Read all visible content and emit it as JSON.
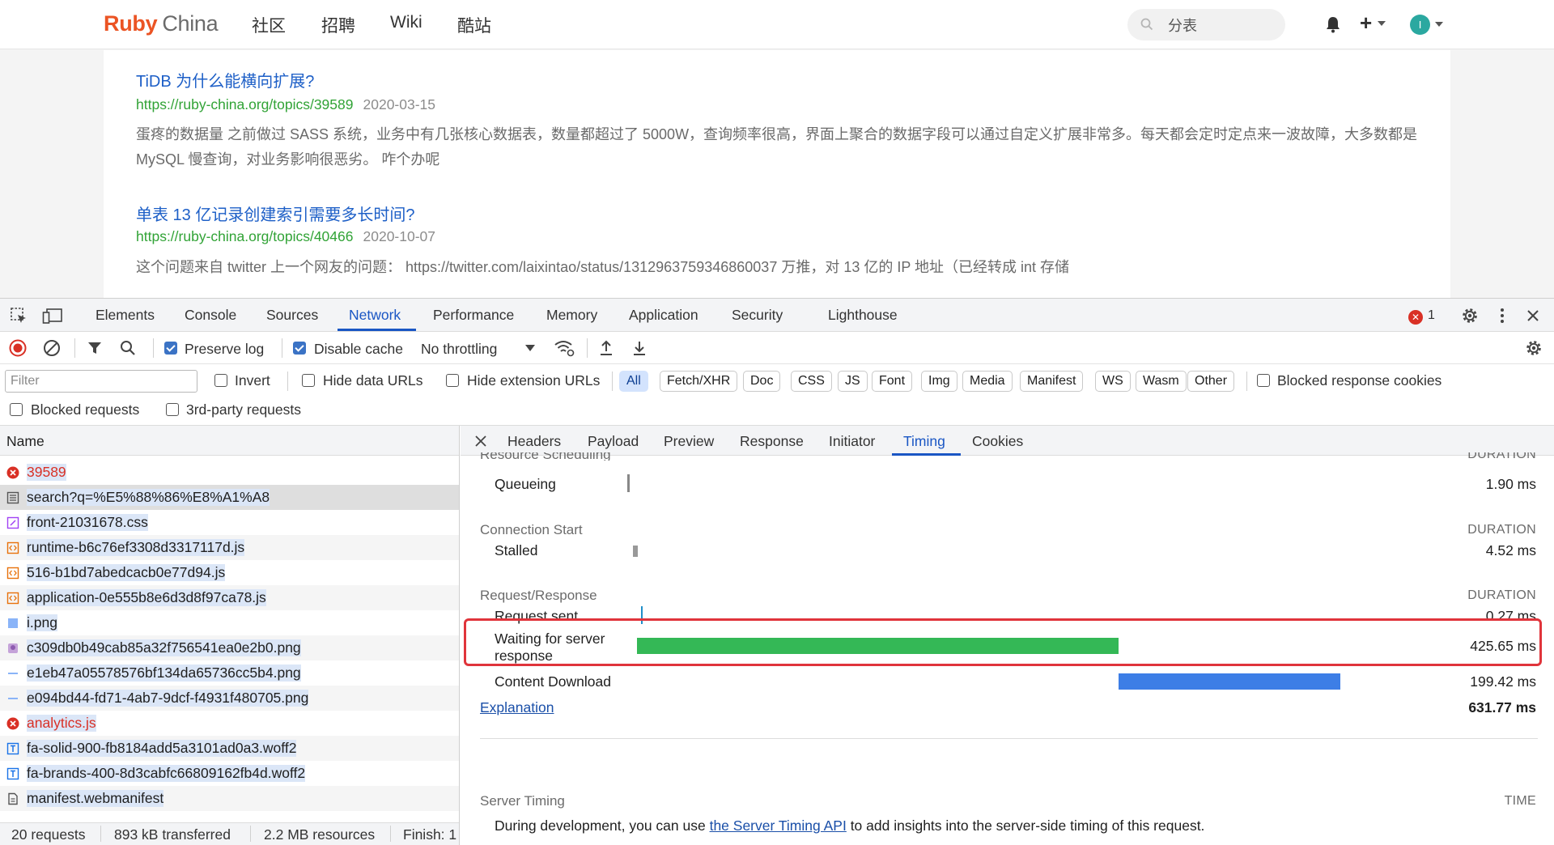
{
  "site": {
    "logo_ruby": "Ruby",
    "logo_china": "China",
    "nav": [
      "社区",
      "招聘",
      "Wiki",
      "酷站"
    ],
    "search_value": "分表",
    "avatar_letter": "I",
    "results": [
      {
        "title": "TiDB 为什么能横向扩展?",
        "url": "https://ruby-china.org/topics/39589",
        "date": "2020-03-15",
        "desc": "蛋疼的数据量 之前做过 SASS 系统，业务中有几张核心数据表，数量都超过了 5000W，查询频率很高，界面上聚合的数据字段可以通过自定义扩展非常多。每天都会定时定点来一波故障，大多数都是 MySQL 慢查询，对业务影响很恶劣。 咋个办呢"
      },
      {
        "title": "单表 13 亿记录创建索引需要多长时间?",
        "url": "https://ruby-china.org/topics/40466",
        "date": "2020-10-07",
        "desc": "这个问题来自 twitter 上一个网友的问题： https://twitter.com/laixintao/status/1312963759346860037 万推，对 13 亿的 IP 地址（已经转成 int 存储"
      }
    ]
  },
  "devtools": {
    "tabs": [
      "Elements",
      "Console",
      "Sources",
      "Network",
      "Performance",
      "Memory",
      "Application",
      "Security",
      "Lighthouse"
    ],
    "error_count": "1",
    "toolbar": {
      "preserve_log": "Preserve log",
      "disable_cache": "Disable cache",
      "throttling": "No throttling"
    },
    "filter": {
      "placeholder": "Filter",
      "invert": "Invert",
      "hide_data_urls": "Hide data URLs",
      "hide_extension_urls": "Hide extension URLs",
      "types": [
        "All",
        "Fetch/XHR",
        "Doc",
        "CSS",
        "JS",
        "Font",
        "Img",
        "Media",
        "Manifest",
        "WS",
        "Wasm",
        "Other"
      ],
      "blocked_response_cookies": "Blocked response cookies",
      "blocked_requests": "Blocked requests",
      "third_party_requests": "3rd-party requests"
    },
    "requests": {
      "header": "Name",
      "items": [
        {
          "name": "39589",
          "kind": "error"
        },
        {
          "name": "search?q=%E5%88%86%E8%A1%A8",
          "kind": "doc"
        },
        {
          "name": "front-21031678.css",
          "kind": "css"
        },
        {
          "name": "runtime-b6c76ef3308d3317117d.js",
          "kind": "js"
        },
        {
          "name": "516-b1bd7abedcacb0e77d94.js",
          "kind": "js"
        },
        {
          "name": "application-0e555b8e6d3d8f97ca78.js",
          "kind": "js"
        },
        {
          "name": "i.png",
          "kind": "img"
        },
        {
          "name": "c309db0b49cab85a32f756541ea0e2b0.png",
          "kind": "img2"
        },
        {
          "name": "e1eb47a05578576bf134da65736cc5b4.png",
          "kind": "img3"
        },
        {
          "name": "e094bd44-fd71-4ab7-9dcf-f4931f480705.png",
          "kind": "img3"
        },
        {
          "name": "analytics.js",
          "kind": "error"
        },
        {
          "name": "fa-solid-900-fb8184add5a3101ad0a3.woff2",
          "kind": "font"
        },
        {
          "name": "fa-brands-400-8d3cabfc66809162fb4d.woff2",
          "kind": "font"
        },
        {
          "name": "manifest.webmanifest",
          "kind": "manifest"
        }
      ],
      "status": {
        "requests": "20 requests",
        "transferred": "893 kB transferred",
        "resources": "2.2 MB resources",
        "finish": "Finish: 1"
      }
    },
    "detail": {
      "tabs": [
        "Headers",
        "Payload",
        "Preview",
        "Response",
        "Initiator",
        "Timing",
        "Cookies"
      ],
      "sections": {
        "scheduling": "Resource Scheduling",
        "connection": "Connection Start",
        "request": "Request/Response",
        "duration": "DURATION",
        "server_timing": "Server Timing",
        "time": "TIME"
      },
      "timing": [
        {
          "label": "Queueing",
          "value": "1.90 ms",
          "ms": 1.9
        },
        {
          "label": "Stalled",
          "value": "4.52 ms",
          "ms": 4.52
        },
        {
          "label": "Request sent",
          "value": "0.27 ms",
          "ms": 0.27
        },
        {
          "label": "Waiting for server response",
          "value": "425.65 ms",
          "ms": 425.65
        },
        {
          "label": "Content Download",
          "value": "199.42 ms",
          "ms": 199.42
        }
      ],
      "explanation": "Explanation",
      "total": "631.77 ms",
      "server_note_pre": "During development, you can use ",
      "server_note_link": "the Server Timing API",
      "server_note_post": " to add insights into the server-side timing of this request."
    },
    "colors": {
      "waiting": "#34b856",
      "download": "#3d7ee6",
      "highlight": "#e0343b"
    }
  }
}
